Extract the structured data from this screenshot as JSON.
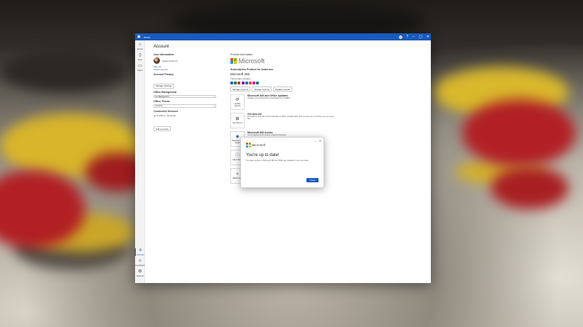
{
  "window": {
    "app_name": "Word",
    "colors": {
      "accent": "#185abd",
      "titlebar": "#185abd"
    }
  },
  "nav": {
    "home": "Home",
    "new": "New",
    "open": "Open",
    "account": "Account",
    "feedback": "Feedback",
    "options": "Options"
  },
  "page": {
    "title": "Account"
  },
  "user": {
    "heading": "User Information",
    "name": "Ayaan Anderson",
    "sign_out": "Sign out",
    "switch_account": "Switch account"
  },
  "privacy": {
    "heading": "Account Privacy",
    "manage_button": "Manage Settings"
  },
  "background": {
    "heading": "Office Background",
    "value": "No Background"
  },
  "theme": {
    "heading": "Office Theme",
    "value": "Colorful"
  },
  "services": {
    "heading": "Connected Services",
    "item": "OneDrive - Personal",
    "add_button": "Add a service"
  },
  "product": {
    "heading": "Product Information",
    "brand": "Microsoft",
    "subscription_heading": "Subscription Product for Anderson",
    "name": "Microsoft 365",
    "contains_label": "This product contains",
    "buttons": [
      "Manage Account",
      "Change License",
      "Update License"
    ],
    "app_colors": [
      "#185abd",
      "#107c41",
      "#c43e1c",
      "#7719aa",
      "#0f6cbd",
      "#d35230",
      "#e3008c",
      "#03787c"
    ]
  },
  "updates": {
    "tile_label": "Update Options",
    "title": "Microsoft 365 and Office Updates",
    "desc": "Updates are automatically downloaded and installed."
  },
  "addins": {
    "tile_label": "Get Add-ins",
    "title": "Get Add-ins",
    "desc": "Find add-ins that add new functionality to Office, simplify tasks, and connect you to services you use every day."
  },
  "insider": {
    "tile_label": "Microsoft 365 Insider",
    "title": "Microsoft 365 Insider",
    "bullet": "You're signed up for Current Channel (Preview)"
  },
  "about": {
    "tile_label": "About Word"
  },
  "whats_new": {
    "tile_label": "What's New"
  },
  "dialog": {
    "brand": "Microsoft",
    "title": "You're up to date!",
    "message": "The latest version of Microsoft 365 and Office are installed on your computer.",
    "close_button": "Close",
    "minimize_glyph": "–",
    "close_glyph": "✕"
  }
}
